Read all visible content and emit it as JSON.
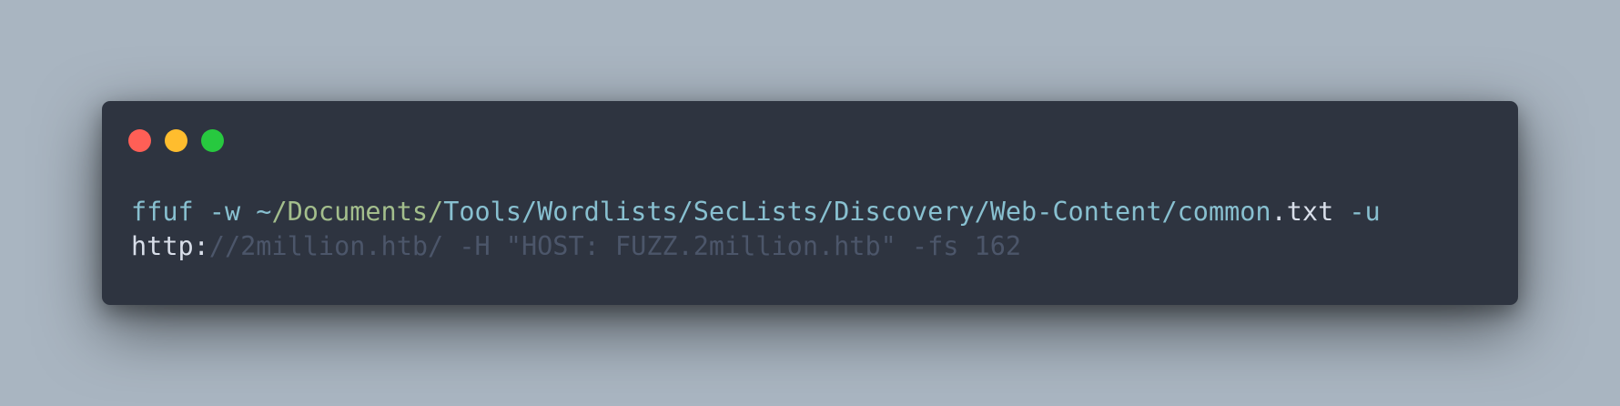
{
  "window": {
    "controls": [
      "close",
      "minimize",
      "maximize"
    ]
  },
  "terminal": {
    "lines": [
      [
        {
          "text": "ffuf -w ~",
          "color": "#88c0d0"
        },
        {
          "text": "/Documents/",
          "color": "#a3be8c"
        },
        {
          "text": "Tools/Wordlists/SecLists/Discovery/Web-Content/common",
          "color": "#88c0d0"
        },
        {
          "text": ".txt ",
          "color": "#d8dee9"
        },
        {
          "text": "-u",
          "color": "#88c0d0"
        }
      ],
      [
        {
          "text": "http:",
          "color": "#d8dee9"
        },
        {
          "text": "//2million.htb/ -H \"HOST: FUZZ.2million.htb\" -fs 162",
          "color": "#4c566a"
        }
      ]
    ]
  }
}
